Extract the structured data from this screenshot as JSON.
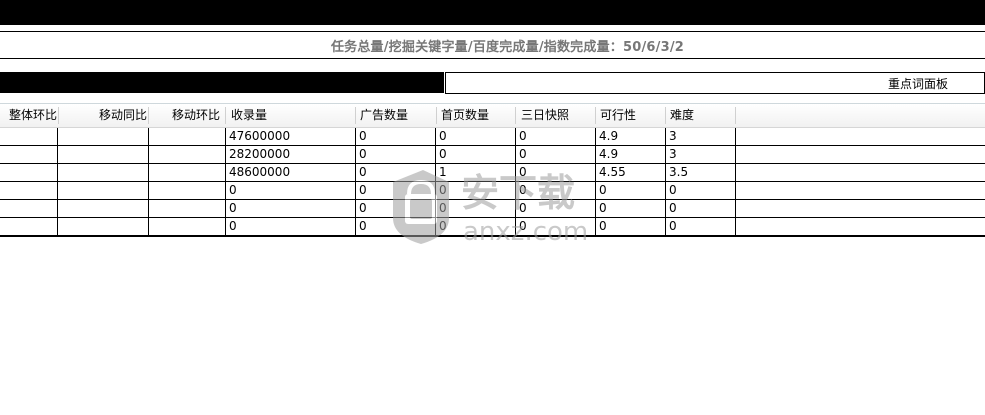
{
  "status": {
    "text": "任务总量/挖掘关键字量/百度完成量/指数完成量：50/6/3/2"
  },
  "panel": {
    "title": "重点词面板"
  },
  "table": {
    "columns": [
      "整体环比",
      "移动同比",
      "移动环比",
      "收录量",
      "广告数量",
      "首页数量",
      "三日快照",
      "可行性",
      "难度"
    ],
    "rows": [
      {
        "c0": "",
        "c1": "",
        "c2": "",
        "c3": "47600000",
        "c4": "0",
        "c5": "0",
        "c6": "0",
        "c7": "4.9",
        "c8": "3"
      },
      {
        "c0": "",
        "c1": "",
        "c2": "",
        "c3": "28200000",
        "c4": "0",
        "c5": "0",
        "c6": "0",
        "c7": "4.9",
        "c8": "3"
      },
      {
        "c0": "",
        "c1": "",
        "c2": "",
        "c3": "48600000",
        "c4": "0",
        "c5": "1",
        "c6": "0",
        "c7": "4.55",
        "c8": "3.5"
      },
      {
        "c0": "",
        "c1": "",
        "c2": "",
        "c3": "0",
        "c4": "0",
        "c5": "0",
        "c6": "0",
        "c7": "0",
        "c8": "0"
      },
      {
        "c0": "",
        "c1": "",
        "c2": "",
        "c3": "0",
        "c4": "0",
        "c5": "0",
        "c6": "0",
        "c7": "0",
        "c8": "0"
      },
      {
        "c0": "",
        "c1": "",
        "c2": "",
        "c3": "0",
        "c4": "0",
        "c5": "0",
        "c6": "0",
        "c7": "0",
        "c8": "0"
      }
    ]
  },
  "watermark": {
    "text": "安下载",
    "url": "anxz.com",
    "icon": "shield-bag-icon",
    "color": "#9e9e9e"
  }
}
